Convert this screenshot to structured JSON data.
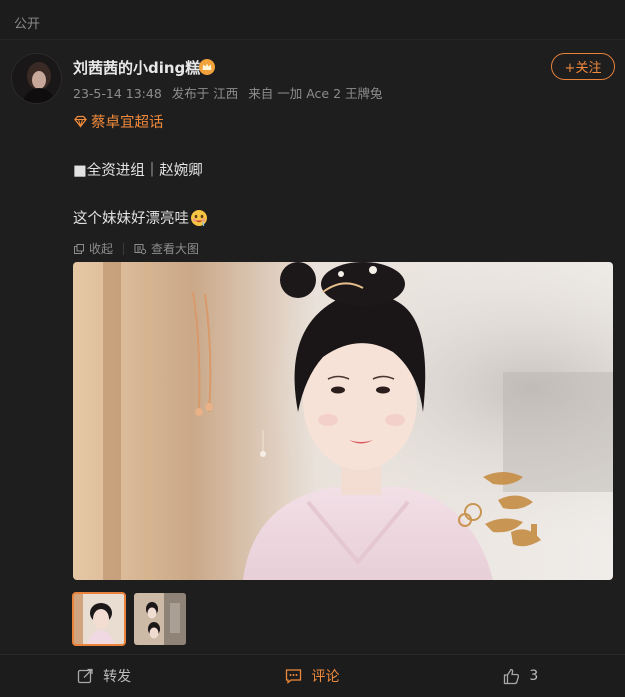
{
  "visibility": {
    "label": "公开"
  },
  "post": {
    "author": "刘茜茜的小ding糕",
    "timestamp": "23-5-14 13:48",
    "location": "发布于 江西",
    "device": "来自 一加 Ace 2 王牌兔",
    "follow_label": "+关注",
    "topic": "蔡卓宜超话",
    "line2": "■全资进组｜赵婉卿",
    "line3": "这个妹妹好漂亮哇",
    "emoji_icon": "drooling-face-emoji",
    "accent": "#f08a3c"
  },
  "image_toolbar": {
    "collapse_label": "收起",
    "view_large_label": "查看大图"
  },
  "thumbnails": [
    {
      "icon": "thumbnail-1",
      "selected": true
    },
    {
      "icon": "thumbnail-2",
      "selected": false
    }
  ],
  "actions": {
    "repost_label": "转发",
    "comment_label": "评论",
    "like_count": "3"
  }
}
